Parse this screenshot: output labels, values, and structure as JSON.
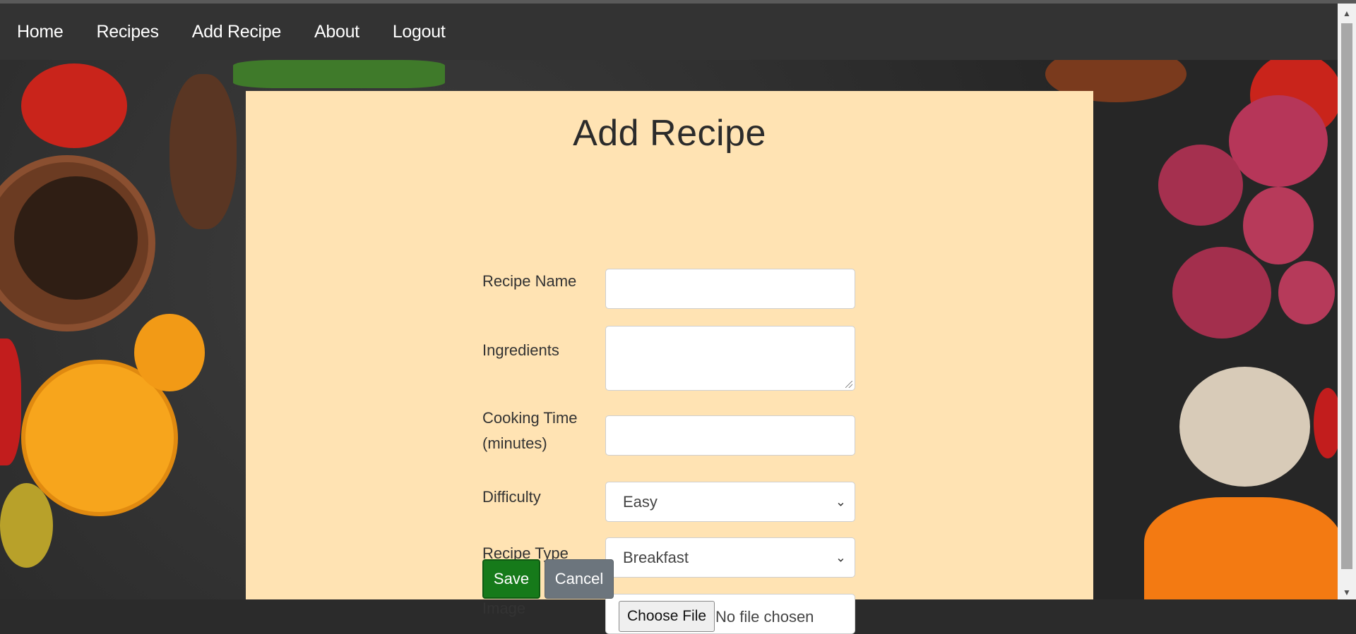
{
  "nav": {
    "items": [
      {
        "label": "Home"
      },
      {
        "label": "Recipes"
      },
      {
        "label": "Add Recipe"
      },
      {
        "label": "About"
      },
      {
        "label": "Logout"
      }
    ]
  },
  "form": {
    "title": "Add Recipe",
    "recipe_name_label": "Recipe Name",
    "recipe_name_value": "",
    "ingredients_label": "Ingredients",
    "ingredients_value": "",
    "cooking_time_label_line1": "Cooking Time",
    "cooking_time_label_line2": "(minutes)",
    "cooking_time_value": "",
    "difficulty_label": "Difficulty",
    "difficulty_selected": "Easy",
    "recipe_type_label": "Recipe Type",
    "recipe_type_selected": "Breakfast",
    "image_label": "Image",
    "file_button_label": "Choose File",
    "file_status": "No file chosen",
    "save_label": "Save",
    "cancel_label": "Cancel"
  },
  "colors": {
    "navbar": "#333333",
    "panel": "#ffe3b3",
    "save_button": "#167a1a",
    "cancel_button": "#6c757d"
  }
}
